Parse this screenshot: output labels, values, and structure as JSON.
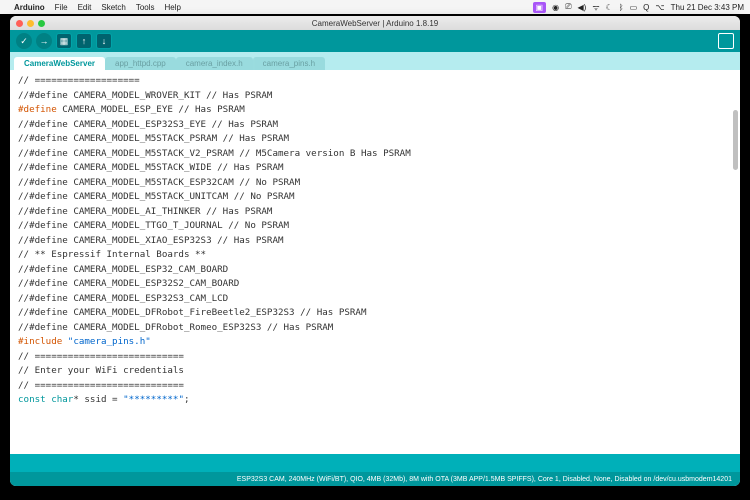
{
  "menubar": {
    "appname": "Arduino",
    "items": [
      "File",
      "Edit",
      "Sketch",
      "Tools",
      "Help"
    ],
    "datetime": "Thu 21 Dec  3:43 PM"
  },
  "window": {
    "title": "CameraWebServer | Arduino 1.8.19"
  },
  "tabs": {
    "items": [
      {
        "label": "CameraWebServer",
        "active": true
      },
      {
        "label": "app_httpd.cpp",
        "active": false
      },
      {
        "label": "camera_index.h",
        "active": false
      },
      {
        "label": "camera_pins.h",
        "active": false
      }
    ]
  },
  "code": {
    "lines": [
      {
        "t": "comment",
        "text": "// ==================="
      },
      {
        "t": "comment",
        "text": "//#define CAMERA_MODEL_WROVER_KIT // Has PSRAM"
      },
      {
        "t": "define",
        "kw": "#define",
        "rest": " CAMERA_MODEL_ESP_EYE // Has PSRAM"
      },
      {
        "t": "comment",
        "text": "//#define CAMERA_MODEL_ESP32S3_EYE // Has PSRAM"
      },
      {
        "t": "comment",
        "text": "//#define CAMERA_MODEL_M5STACK_PSRAM // Has PSRAM"
      },
      {
        "t": "comment",
        "text": "//#define CAMERA_MODEL_M5STACK_V2_PSRAM // M5Camera version B Has PSRAM"
      },
      {
        "t": "comment",
        "text": "//#define CAMERA_MODEL_M5STACK_WIDE // Has PSRAM"
      },
      {
        "t": "comment",
        "text": "//#define CAMERA_MODEL_M5STACK_ESP32CAM // No PSRAM"
      },
      {
        "t": "comment",
        "text": "//#define CAMERA_MODEL_M5STACK_UNITCAM // No PSRAM"
      },
      {
        "t": "comment",
        "text": "//#define CAMERA_MODEL_AI_THINKER // Has PSRAM"
      },
      {
        "t": "comment",
        "text": "//#define CAMERA_MODEL_TTGO_T_JOURNAL // No PSRAM"
      },
      {
        "t": "comment",
        "text": "//#define CAMERA_MODEL_XIAO_ESP32S3 // Has PSRAM"
      },
      {
        "t": "comment",
        "text": "// ** Espressif Internal Boards **"
      },
      {
        "t": "comment",
        "text": "//#define CAMERA_MODEL_ESP32_CAM_BOARD"
      },
      {
        "t": "comment",
        "text": "//#define CAMERA_MODEL_ESP32S2_CAM_BOARD"
      },
      {
        "t": "comment",
        "text": "//#define CAMERA_MODEL_ESP32S3_CAM_LCD"
      },
      {
        "t": "comment",
        "text": "//#define CAMERA_MODEL_DFRobot_FireBeetle2_ESP32S3 // Has PSRAM"
      },
      {
        "t": "comment",
        "text": "//#define CAMERA_MODEL_DFRobot_Romeo_ESP32S3 // Has PSRAM"
      },
      {
        "t": "include",
        "kw": "#include",
        "str": " \"camera_pins.h\""
      },
      {
        "t": "blank",
        "text": ""
      },
      {
        "t": "comment",
        "text": "// ==========================="
      },
      {
        "t": "comment",
        "text": "// Enter your WiFi credentials"
      },
      {
        "t": "comment",
        "text": "// ==========================="
      },
      {
        "t": "decl",
        "type": "const char",
        "rest": "* ssid = ",
        "str": "\"*********\"",
        "tail": ";"
      }
    ]
  },
  "footer": {
    "status": "ESP32S3 CAM, 240MHz (WiFi/BT), QIO, 4MB (32Mb), 8M with OTA (3MB APP/1.5MB SPIFFS), Core 1, Disabled, None, Disabled on /dev/cu.usbmodem14201"
  }
}
